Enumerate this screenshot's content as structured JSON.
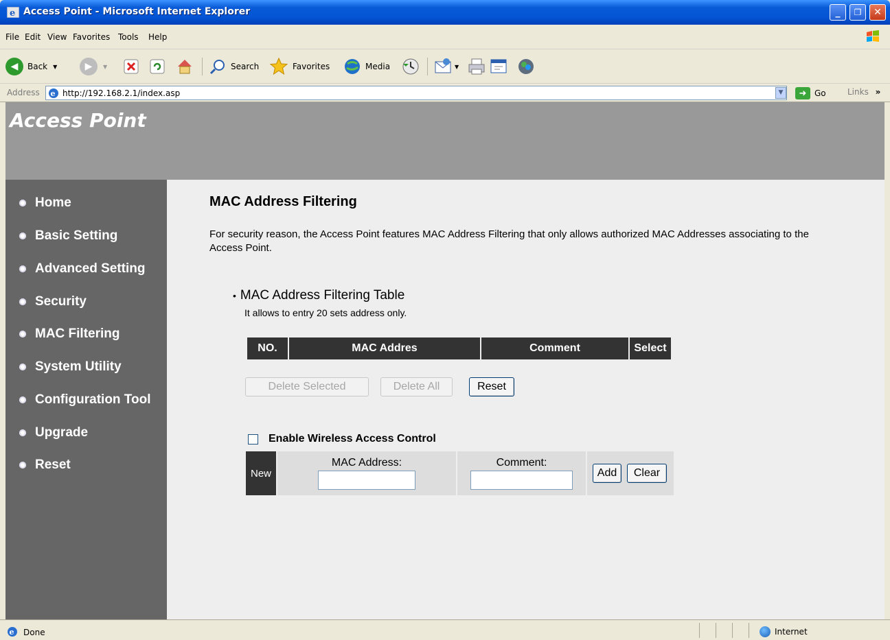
{
  "window": {
    "title": "Access Point - Microsoft Internet Explorer",
    "controls": {
      "minimize": "_",
      "maximize": "❐",
      "close": "✕"
    }
  },
  "menubar": {
    "items": [
      "File",
      "Edit",
      "View",
      "Favorites",
      "Tools",
      "Help"
    ]
  },
  "toolbar": {
    "back_label": "Back",
    "search_label": "Search",
    "favorites_label": "Favorites",
    "media_label": "Media",
    "icons": [
      "back-icon",
      "forward-icon",
      "stop-icon",
      "refresh-icon",
      "home-icon",
      "search-icon",
      "favorites-icon",
      "media-icon",
      "history-icon",
      "mail-icon",
      "print-icon",
      "edit-icon",
      "messenger-icon"
    ]
  },
  "addressbar": {
    "label": "Address",
    "url": "http://192.168.2.1/index.asp",
    "go_label": "Go",
    "links_label": "Links",
    "links_chevron": "»"
  },
  "page": {
    "brand": "Access Point",
    "nav": [
      {
        "label": "Home"
      },
      {
        "label": "Basic Setting"
      },
      {
        "label": "Advanced Setting"
      },
      {
        "label": "Security"
      },
      {
        "label": "MAC Filtering"
      },
      {
        "label": "System Utility"
      },
      {
        "label": "Configuration Tool"
      },
      {
        "label": "Upgrade"
      },
      {
        "label": "Reset"
      }
    ],
    "title": "MAC Address Filtering",
    "description": "For security reason, the Access Point features MAC Address Filtering that only allows authorized MAC Addresses associating to the Access Point.",
    "table_section": {
      "bullet": "•",
      "title": "MAC Address Filtering Table",
      "note": "It allows to entry 20 sets address only.",
      "columns": [
        "NO.",
        "MAC Addres",
        "Comment",
        "Select"
      ]
    },
    "buttons": {
      "delete_selected": "Delete Selected",
      "delete_all": "Delete All",
      "reset": "Reset"
    },
    "access_control": {
      "checkbox_label": "Enable Wireless Access Control",
      "checked": false,
      "new_label": "New",
      "mac_label": "MAC Address:",
      "mac_value": "",
      "comment_label": "Comment:",
      "comment_value": "",
      "add_label": "Add",
      "clear_label": "Clear"
    }
  },
  "statusbar": {
    "status": "Done",
    "zone": "Internet"
  },
  "colors": {
    "banner": "#999999",
    "sidebar": "#666666",
    "table_header": "#333333",
    "content_bg": "#eeeeee",
    "titlebar": "#0454d4"
  }
}
